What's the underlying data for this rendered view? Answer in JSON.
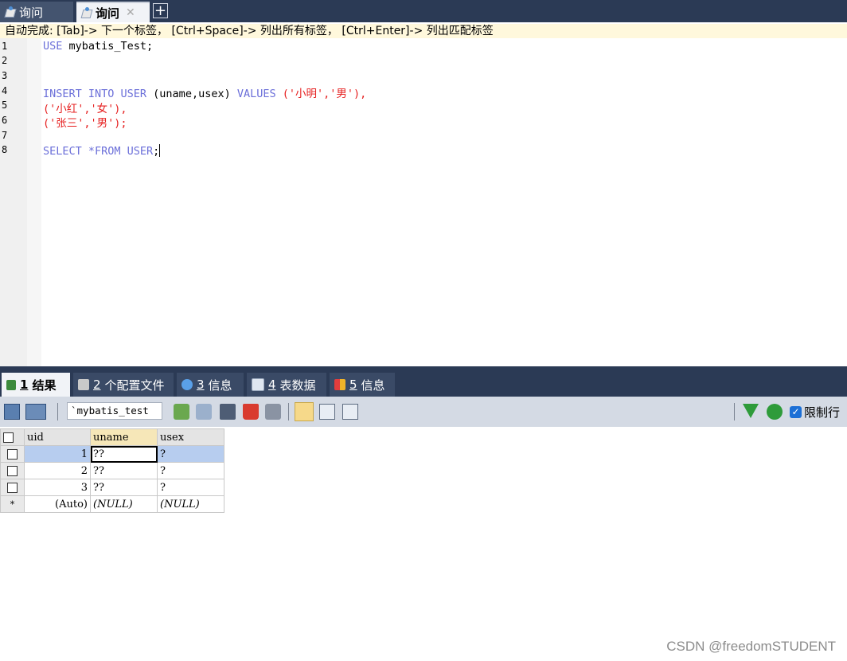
{
  "query_tabs": [
    {
      "label": "询问",
      "active": false
    },
    {
      "label": "询问",
      "active": true,
      "close": "✕"
    }
  ],
  "new_tab_symbol": "+",
  "hint": "自动完成: [Tab]-> 下一个标签， [Ctrl+Space]-> 列出所有标签， [Ctrl+Enter]-> 列出匹配标签",
  "editor": {
    "line_numbers": [
      "1",
      "2",
      "3",
      "4",
      "5",
      "6",
      "7",
      "8"
    ],
    "l1": {
      "kw": "USE",
      "rest": " mybatis_Test;"
    },
    "l4": {
      "kw1": "INSERT INTO USER",
      "cols": " (uname,usex) ",
      "kw2": "VALUES",
      "vals": " ('小明','男'),"
    },
    "l5": "('小红','女'),",
    "l6": "('张三','男');",
    "l8": {
      "kw": "SELECT *FROM USER",
      "rest": ";"
    }
  },
  "result_tabs": [
    {
      "num": "1",
      "label": "结果"
    },
    {
      "num": "2",
      "label": "个配置文件"
    },
    {
      "num": "3",
      "label": "信息"
    },
    {
      "num": "4",
      "label": "表数据"
    },
    {
      "num": "5",
      "label": "信息"
    }
  ],
  "toolbar": {
    "db_select": "`mybatis_test",
    "limit_rows_label": "限制行",
    "limit_rows_checked": true
  },
  "grid": {
    "columns": [
      "uid",
      "uname",
      "usex"
    ],
    "rows": [
      {
        "uid": "1",
        "uname": "??",
        "usex": "?"
      },
      {
        "uid": "2",
        "uname": "??",
        "usex": "?"
      },
      {
        "uid": "3",
        "uname": "??",
        "usex": "?"
      }
    ],
    "new_row_marker": "*",
    "new_row": {
      "uid": "(Auto)",
      "uname": "(NULL)",
      "usex": "(NULL)"
    }
  },
  "watermark": "CSDN @freedomSTUDENT",
  "colors": {
    "keyword": "#6b6fd9",
    "string": "#e62020",
    "chrome": "#2b3a55",
    "selection": "#b7cdef"
  }
}
